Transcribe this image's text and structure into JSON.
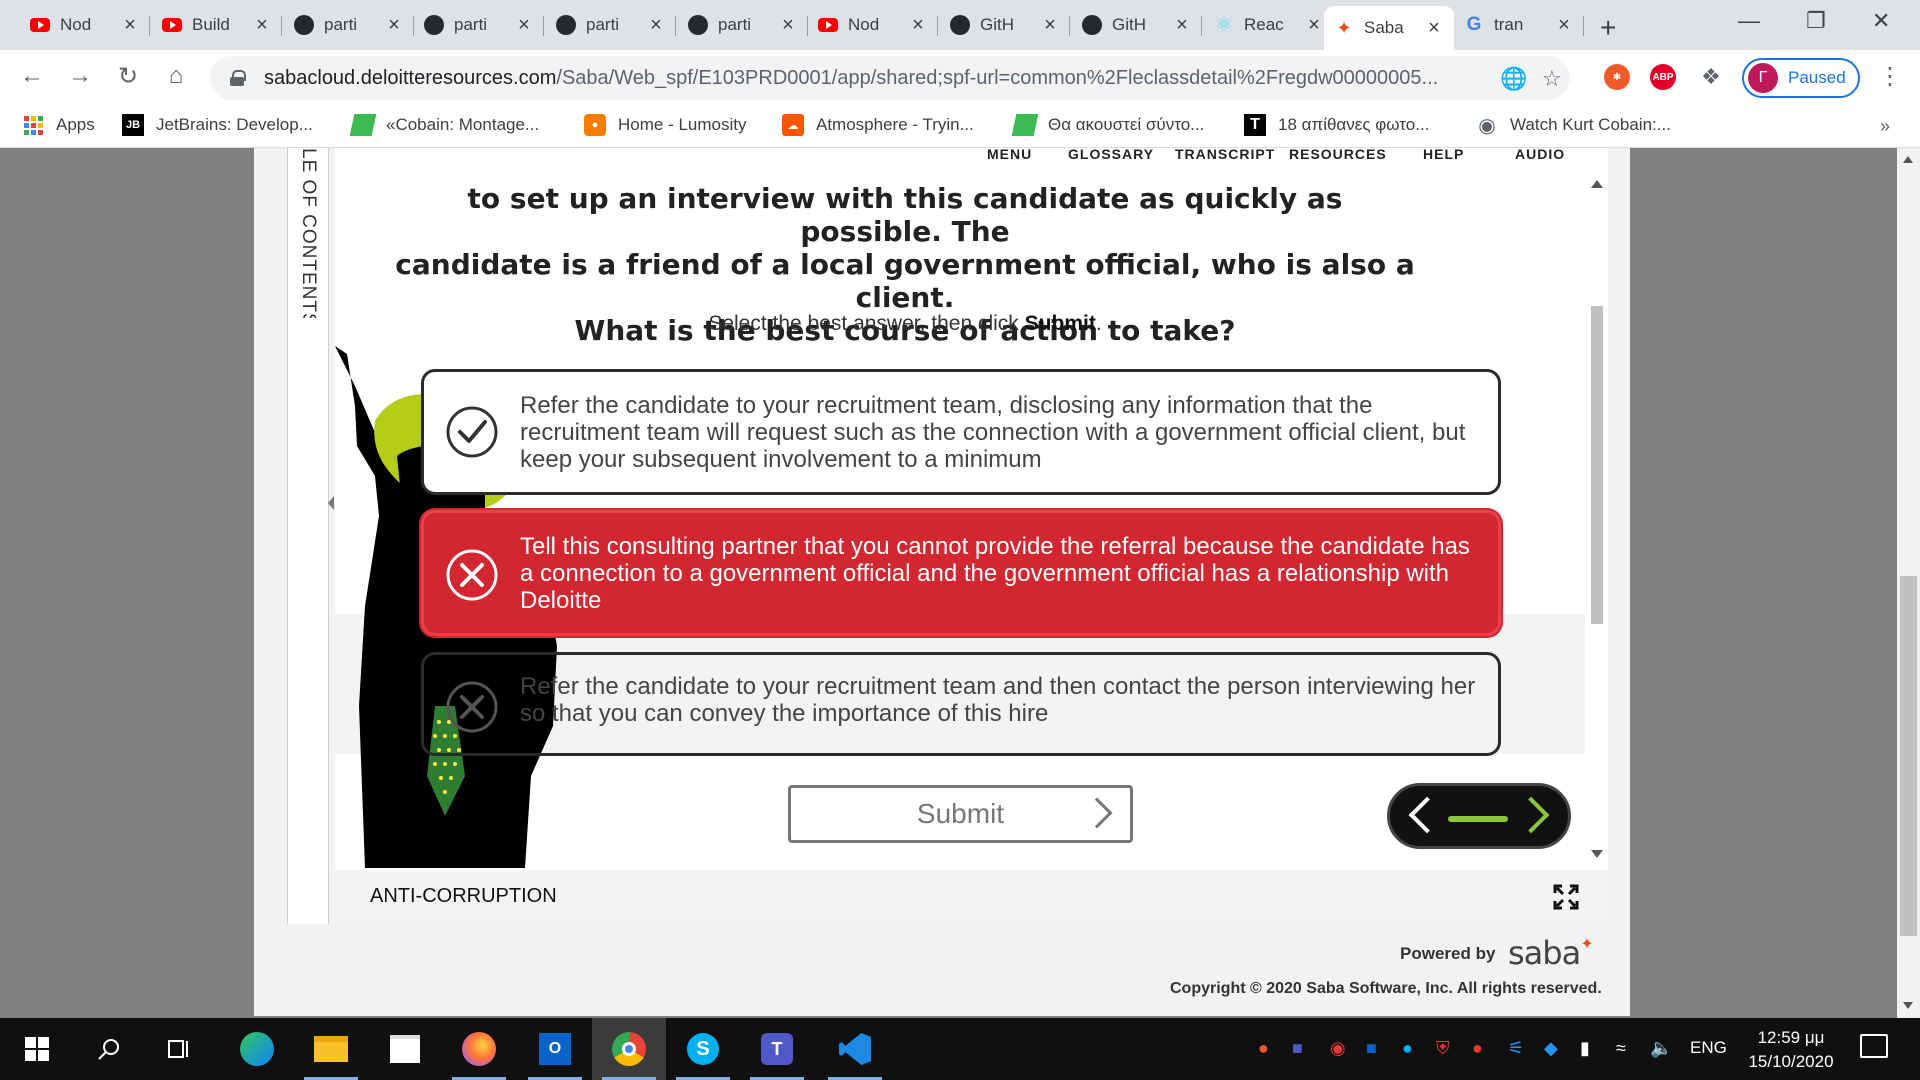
{
  "browser": {
    "tabs": [
      {
        "title": "Nod",
        "icon": "youtube-icon"
      },
      {
        "title": "Build",
        "icon": "youtube-icon"
      },
      {
        "title": "parti",
        "icon": "github-icon"
      },
      {
        "title": "parti",
        "icon": "github-icon"
      },
      {
        "title": "parti",
        "icon": "github-icon"
      },
      {
        "title": "parti",
        "icon": "github-icon"
      },
      {
        "title": "Nod",
        "icon": "youtube-icon"
      },
      {
        "title": "GitH",
        "icon": "github-icon"
      },
      {
        "title": "GitH",
        "icon": "github-icon"
      },
      {
        "title": "Reac",
        "icon": "react-icon"
      },
      {
        "title": "Saba",
        "icon": "saba-icon",
        "active": true
      },
      {
        "title": "tran",
        "icon": "google-icon"
      }
    ],
    "url_host": "sabacloud.deloitteresources.com",
    "url_path": "/Saba/Web_spf/E103PRD0001/app/shared;spf-url=common%2Fleclassdetail%2Fregdw00000005...",
    "profile_initial": "Γ",
    "profile_label": "Paused",
    "bookmarks": [
      {
        "label": "Apps",
        "icon": "apps-grid-icon"
      },
      {
        "label": "JetBrains: Develop...",
        "icon": "jetbrains-icon"
      },
      {
        "label": "«Cobain: Montage...",
        "icon": "bookmark-green-icon"
      },
      {
        "label": "Home - Lumosity",
        "icon": "lumosity-icon"
      },
      {
        "label": "Atmosphere - Tryin...",
        "icon": "soundcloud-icon"
      },
      {
        "label": "Θα ακουστεί σύντο...",
        "icon": "bookmark-green-icon"
      },
      {
        "label": "18 απίθανες φωτο...",
        "icon": "t-logo-icon"
      },
      {
        "label": "Watch Kurt Cobain:...",
        "icon": "globe-icon"
      }
    ],
    "bookmarks_more": "»"
  },
  "colors": {
    "incorrect_red": "#d22630",
    "accent_green": "#8cc63f",
    "chrome_blue": "#1a73e8"
  },
  "course": {
    "toc_label": "LE OF CONTENTS",
    "top_menu": [
      "MENU",
      "GLOSSARY",
      "TRANSCRIPT",
      "RESOURCES",
      "HELP",
      "AUDIO"
    ],
    "question_lines": [
      "to set up an interview with this candidate as quickly as possible. The",
      "candidate is a friend of a local government official, who is also a client.",
      "What is the best course of action to take?"
    ],
    "instruction_prefix": "Select the best answer, then click ",
    "instruction_action": "Submit",
    "instruction_suffix": ".",
    "answers": [
      {
        "text": "Refer the candidate to your recruitment team, disclosing any information that the recruitment team will request such as the connection with a government official client, but keep your subsequent involvement to a minimum",
        "state": "correct"
      },
      {
        "text": "Tell this consulting partner that you cannot provide the referral because the candidate has a connection to a government official and the government official has a relationship with Deloitte",
        "state": "selected-incorrect"
      },
      {
        "text": "Refer the candidate to your recruitment team and then contact the person interviewing her so that you can convey the importance of this hire",
        "state": "incorrect"
      }
    ],
    "submit_label": "Submit",
    "course_title": "ANTI-CORRUPTION"
  },
  "footer": {
    "powered_by": "Powered by",
    "brand": "saba",
    "copyright": "Copyright © 2020 Saba Software, Inc. All rights reserved."
  },
  "taskbar": {
    "language": "ENG",
    "time": "12:59 μμ",
    "date": "15/10/2020"
  }
}
